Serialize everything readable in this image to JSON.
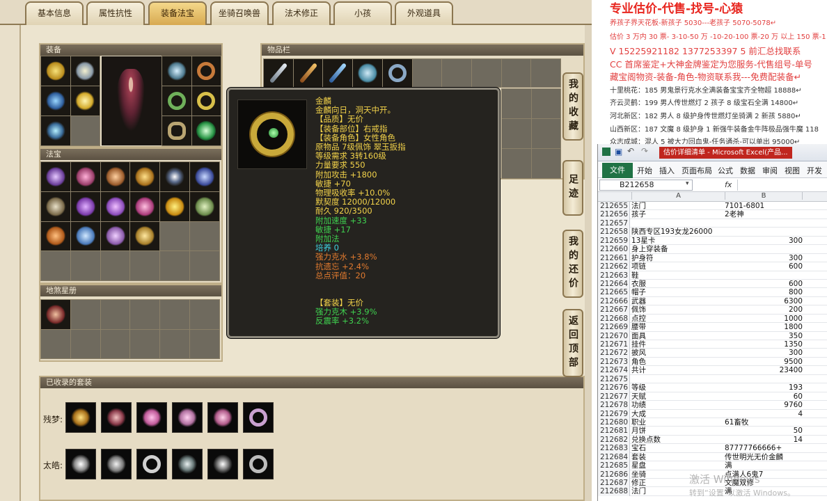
{
  "tabs": [
    "基本信息",
    "属性抗性",
    "装备法宝",
    "坐骑召唤兽",
    "法术修正",
    "小孩",
    "外观道具"
  ],
  "active_tab": "装备法宝",
  "sections": {
    "equip": "装备",
    "items": "物品栏",
    "fabao": "法宝",
    "diche": "地煞星册",
    "suits": "已收录的套装"
  },
  "side_buttons": [
    {
      "label": "我的收藏"
    },
    {
      "label": "足迹"
    },
    {
      "label": "我的还价"
    },
    {
      "label": "返回顶部"
    }
  ],
  "tooltip": {
    "name": "金麟",
    "lines": [
      {
        "text": "金麟向日，洞天中开。",
        "color": "#f2d24a"
      },
      {
        "text": "【品质】无价",
        "color": "#f2d24a"
      },
      {
        "text": "【装备部位】右戒指",
        "color": "#f2d24a"
      },
      {
        "text": "【装备角色】女性角色",
        "color": "#f2d24a"
      },
      {
        "text": "原物品 7级佩饰 翠玉扳指",
        "color": "#f2d24a"
      },
      {
        "text": "等级需求 3转160级",
        "color": "#f2d24a"
      },
      {
        "text": "力量要求 550",
        "color": "#f2d24a"
      },
      {
        "text": "附加攻击 +1800",
        "color": "#f2d24a"
      },
      {
        "text": "敏捷 +70",
        "color": "#f2d24a"
      },
      {
        "text": "物理吸收率 +10.0%",
        "color": "#f2d24a"
      },
      {
        "text": "默契度 12000/12000",
        "color": "#f2d24a"
      },
      {
        "text": "耐久 920/3500",
        "color": "#f2d24a"
      },
      {
        "text": "附加速度 +33",
        "color": "#3fd04f"
      },
      {
        "text": "敏捷 +17",
        "color": "#3fd04f"
      },
      {
        "text": "附加法",
        "color": "#3fd04f"
      },
      {
        "text": "培养 0",
        "color": "#3fd0e0"
      },
      {
        "text": "强力克水 +3.8%",
        "color": "#e07a2f"
      },
      {
        "text": "抗遗忘 +2.4%",
        "color": "#e07a2f"
      },
      {
        "text": "总点评值：20",
        "color": "#e07a2f"
      },
      {
        "text": "",
        "color": "#f2d24a"
      },
      {
        "text": "",
        "color": "#f2d24a"
      },
      {
        "text": "【套装】无价",
        "color": "#f2d24a"
      },
      {
        "text": "强力克木 +3.9%",
        "color": "#3fd04f"
      },
      {
        "text": "反震率 +3.2%",
        "color": "#3fd04f"
      }
    ]
  },
  "suits": [
    {
      "label": "残梦:"
    },
    {
      "label": "太皓:"
    }
  ],
  "ads": {
    "headline": "专业估价-代售-找号-心猿",
    "lines": [
      "养孩子界天花板-新孩子 5030---老孩子 5070-5078↵",
      "估价 3 万内 30 票- 3-10-50 万 -10-20-100 票-20 万 以上 150 票-1 票 1",
      "V 15225921182   1377253397 5   前汇总找联系",
      "CC 首席鉴定+大神金牌鉴定为您服务-代售组号-单号",
      "藏宝阁物资-装备-角色-物资联系我---免费配装备↵",
      "十里桃花：185 男鬼景行克水全满装备宝宝齐全物超 18888↵",
      "齐云灵鹤：199 男人传世燃灯 2 孩子 8 级宝石全满 14800↵",
      "河北新区：182 男人 8 级护身传世燃灯坐骑满 2 新孩 5880↵",
      "山西新区：187 文魔 8 级护身 1 新强牛装备金牛阵极品强牛魔 118",
      "众志成城：混人 5 被大力回血鬼-任务通杀-可以单出 95000↵"
    ]
  },
  "excel": {
    "title": "估价详细清单 - Microsoft Excel(产品...",
    "file_tab": "文件",
    "ribbon_tabs": [
      "开始",
      "插入",
      "页面布局",
      "公式",
      "数据",
      "审阅",
      "视图",
      "开发工具"
    ],
    "namebox": "B212658",
    "fx": "fx",
    "col_a": "A",
    "col_b": "B",
    "rows": [
      {
        "n": "212655",
        "a": "法门",
        "b": "7101-6801",
        "num": false
      },
      {
        "n": "212656",
        "a": "孩子",
        "b": "2老神",
        "num": false
      },
      {
        "n": "212657",
        "a": "",
        "b": "",
        "num": false
      },
      {
        "n": "212658",
        "a": "陕西专区193女龙26000",
        "b": "",
        "num": false
      },
      {
        "n": "212659",
        "a": "13星卡",
        "b": "300",
        "num": true
      },
      {
        "n": "212660",
        "a": "身上穿装备",
        "b": "",
        "num": false
      },
      {
        "n": "212661",
        "a": "护身符",
        "b": "300",
        "num": true
      },
      {
        "n": "212662",
        "a": "项链",
        "b": "600",
        "num": true
      },
      {
        "n": "212663",
        "a": "鞋",
        "b": "",
        "num": false
      },
      {
        "n": "212664",
        "a": "衣服",
        "b": "600",
        "num": true
      },
      {
        "n": "212665",
        "a": "帽子",
        "b": "800",
        "num": true
      },
      {
        "n": "212666",
        "a": "武器",
        "b": "6300",
        "num": true
      },
      {
        "n": "212667",
        "a": "佩饰",
        "b": "200",
        "num": true
      },
      {
        "n": "212668",
        "a": "点控",
        "b": "1000",
        "num": true
      },
      {
        "n": "212669",
        "a": "腰带",
        "b": "1800",
        "num": true
      },
      {
        "n": "212670",
        "a": "面具",
        "b": "350",
        "num": true
      },
      {
        "n": "212671",
        "a": "挂件",
        "b": "1350",
        "num": true
      },
      {
        "n": "212672",
        "a": "披风",
        "b": "300",
        "num": true
      },
      {
        "n": "212673",
        "a": "角色",
        "b": "9500",
        "num": true
      },
      {
        "n": "212674",
        "a": "共计",
        "b": "23400",
        "num": true
      },
      {
        "n": "212675",
        "a": "",
        "b": "",
        "num": false
      },
      {
        "n": "212676",
        "a": "等级",
        "b": "193",
        "num": true
      },
      {
        "n": "212677",
        "a": "天赋",
        "b": "60",
        "num": true
      },
      {
        "n": "212678",
        "a": "功绩",
        "b": "9760",
        "num": true
      },
      {
        "n": "212679",
        "a": "大成",
        "b": "4",
        "num": true
      },
      {
        "n": "212680",
        "a": "职业",
        "b": "61畜牧",
        "num": false
      },
      {
        "n": "212681",
        "a": "月饼",
        "b": "50",
        "num": true
      },
      {
        "n": "212682",
        "a": "兑换点数",
        "b": "14",
        "num": true
      },
      {
        "n": "212683",
        "a": "宝石",
        "b": "87777766666+",
        "num": false
      },
      {
        "n": "212684",
        "a": "套装",
        "b": "传世明光无价金麟",
        "num": false
      },
      {
        "n": "212685",
        "a": "星盘",
        "b": "满",
        "num": false
      },
      {
        "n": "212686",
        "a": "坐骑",
        "b": "点满人6鬼7",
        "num": false
      },
      {
        "n": "212687",
        "a": "修正",
        "b": "文魔双修",
        "num": false
      },
      {
        "n": "212688",
        "a": "法门",
        "b": "满",
        "num": false
      }
    ]
  },
  "watermark": {
    "line1": "激活 Windows",
    "line2": "转到“设置”以激活 Windows。"
  }
}
